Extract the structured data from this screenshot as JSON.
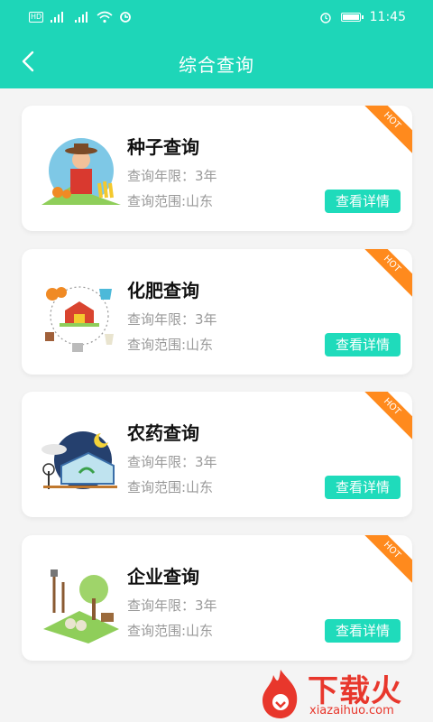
{
  "status_bar": {
    "time": "11:45",
    "hd": "HD"
  },
  "header": {
    "title": "综合查询"
  },
  "cards": [
    {
      "title": "种子查询",
      "years": "查询年限：3年",
      "region": "查询范围:山东",
      "button": "查看详情",
      "badge": "HOT",
      "icon": "farmer-icon"
    },
    {
      "title": "化肥查询",
      "years": "查询年限：3年",
      "region": "查询范围:山东",
      "button": "查看详情",
      "badge": "HOT",
      "icon": "farm-cycle-icon"
    },
    {
      "title": "农药查询",
      "years": "查询年限：3年",
      "region": "查询范围:山东",
      "button": "查看详情",
      "badge": "HOT",
      "icon": "greenhouse-icon"
    },
    {
      "title": "企业查询",
      "years": "查询年限：3年",
      "region": "查询范围:山东",
      "button": "查看详情",
      "badge": "HOT",
      "icon": "garden-tools-icon"
    }
  ],
  "watermark": {
    "text": "下载火",
    "sub": "xiazaihuo.com"
  },
  "colors": {
    "accent": "#1ed6b8",
    "ribbon": "#ff8a1d",
    "watermark": "#e8372c"
  }
}
